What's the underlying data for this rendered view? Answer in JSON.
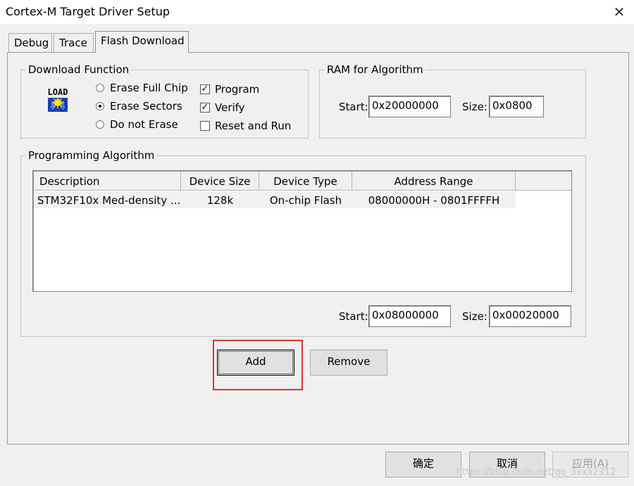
{
  "window": {
    "title": "Cortex-M Target Driver Setup",
    "close_symbol": "✕"
  },
  "tabs": [
    {
      "label": "Debug",
      "active": false
    },
    {
      "label": "Trace",
      "active": false
    },
    {
      "label": "Flash Download",
      "active": true
    }
  ],
  "download_function": {
    "legend": "Download Function",
    "icon": "load-icon",
    "radios": [
      {
        "label": "Erase Full Chip",
        "checked": false
      },
      {
        "label": "Erase Sectors",
        "checked": true
      },
      {
        "label": "Do not Erase",
        "checked": false
      }
    ],
    "checks": [
      {
        "label": "Program",
        "checked": true
      },
      {
        "label": "Verify",
        "checked": true
      },
      {
        "label": "Reset and Run",
        "checked": false
      }
    ]
  },
  "ram": {
    "legend": "RAM for Algorithm",
    "start_label": "Start:",
    "start_value": "0x20000000",
    "size_label": "Size:",
    "size_value": "0x0800"
  },
  "algorithm": {
    "legend": "Programming Algorithm",
    "columns": [
      "Description",
      "Device Size",
      "Device Type",
      "Address Range"
    ],
    "rows": [
      [
        "STM32F10x Med-density ...",
        "128k",
        "On-chip Flash",
        "08000000H - 0801FFFFH"
      ]
    ],
    "start_label": "Start:",
    "start_value": "0x08000000",
    "size_label": "Size:",
    "size_value": "0x00020000"
  },
  "buttons": {
    "add": "Add",
    "remove": "Remove",
    "ok": "确定",
    "cancel": "取消",
    "apply": "应用(A)"
  },
  "watermark": "https://blog.csdn.net/qq_3xxx2312",
  "colors": {
    "highlight": "#e0332e"
  }
}
